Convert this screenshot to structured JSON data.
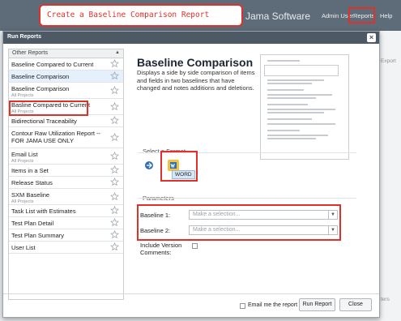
{
  "callout": "Create a Baseline Comparison Report",
  "app": {
    "brand": "Jama Software",
    "nav": {
      "admin": "Admin User",
      "reports": "Reports",
      "help": "Help"
    }
  },
  "background": {
    "export_label": "Export",
    "ters_label": "ters"
  },
  "dialog": {
    "title": "Run Reports",
    "close_glyph": "×",
    "list": {
      "header": "Other Reports",
      "collapse_glyph": "▲",
      "items": [
        {
          "label": "Baseline Compared to Current",
          "sub": ""
        },
        {
          "label": "Baseline Comparison",
          "sub": "",
          "selected": true
        },
        {
          "label": "Baseline Comparison",
          "sub": "All Projects"
        },
        {
          "label": "Basline Compared to Current",
          "sub": "All Projects"
        },
        {
          "label": "Bidirectional Traceability",
          "sub": ""
        },
        {
          "label": "Contour Raw Utilization Report -- FOR JAMA USE ONLY",
          "sub": ""
        },
        {
          "label": "Email List",
          "sub": "All Projects"
        },
        {
          "label": "Items in a Set",
          "sub": ""
        },
        {
          "label": "Release Status",
          "sub": ""
        },
        {
          "label": "SXM Baseline",
          "sub": "All Projects"
        },
        {
          "label": "Task List with Estimates",
          "sub": ""
        },
        {
          "label": "Test Plan Detail",
          "sub": ""
        },
        {
          "label": "Test Plan Summary",
          "sub": ""
        },
        {
          "label": "User List",
          "sub": ""
        }
      ]
    },
    "detail": {
      "title": "Baseline Comparison",
      "description": "Displays a side by side comparison of items and fields in two baselines that have changed and notes additions and deletions."
    },
    "format": {
      "section_label": "Select a Format",
      "word_label": "WORD"
    },
    "parameters": {
      "section_label": "Parameters",
      "baseline1_label": "Baseline 1:",
      "baseline2_label": "Baseline 2:",
      "placeholder": "Make a selection...",
      "include_version_comments": "Include Version Comments:"
    },
    "footer": {
      "email_label": "Email me the report",
      "run_label": "Run Report",
      "close_label": "Close"
    }
  },
  "colors": {
    "highlight": "#e0302a",
    "titlebar": "#4d5a66",
    "selected_row": "#e4f0fb"
  }
}
